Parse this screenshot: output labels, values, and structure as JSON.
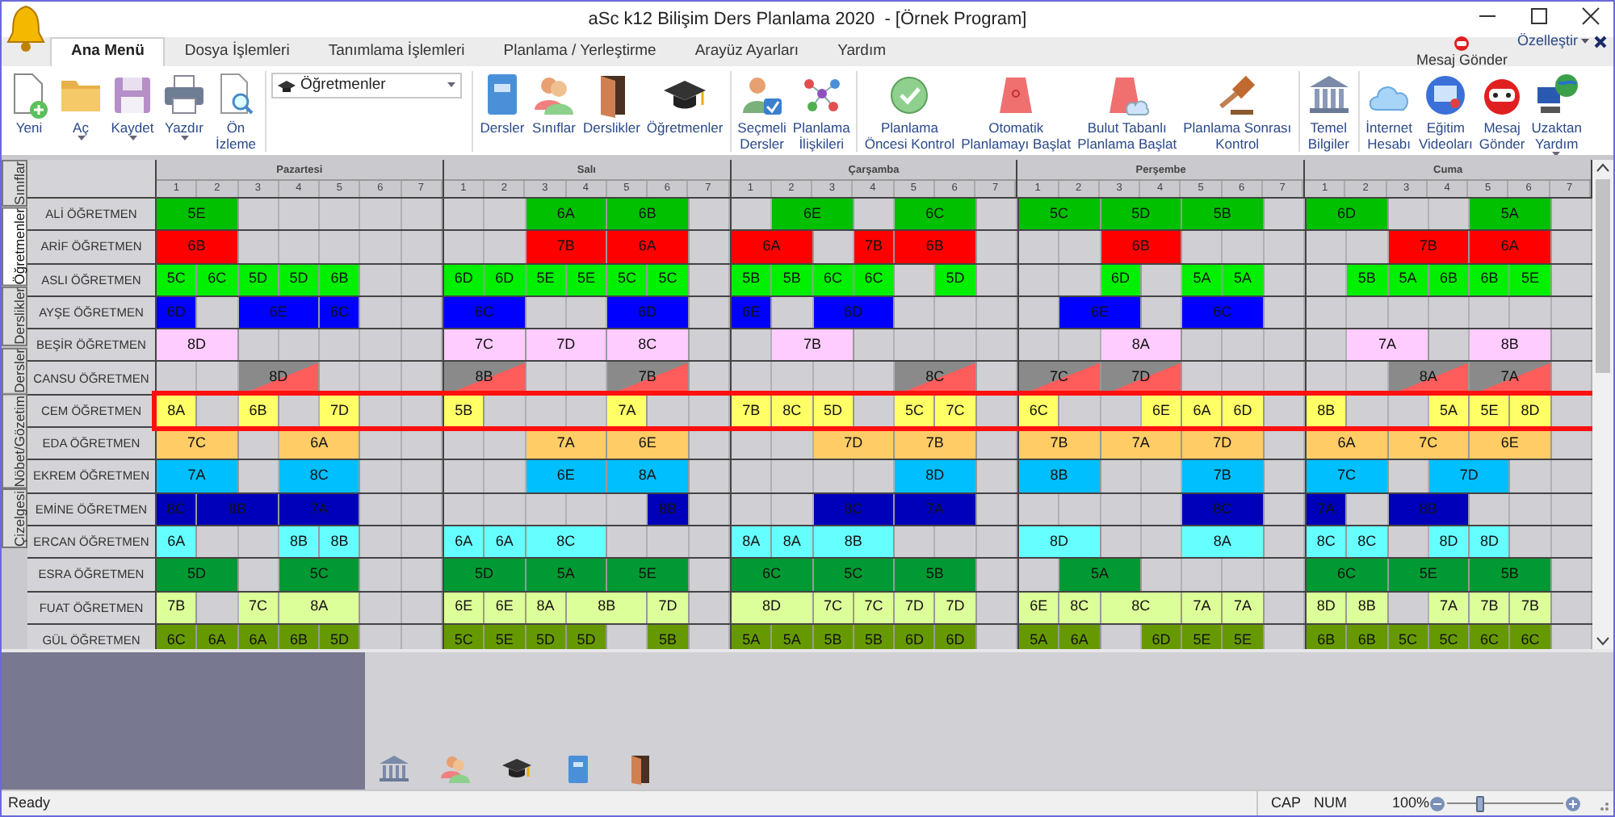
{
  "window": {
    "title": "aSc k12 Bilişim Ders Planlama 2020  - [Örnek Program]"
  },
  "ribbon_tabs": [
    {
      "label": "Ana Menü",
      "selected": true
    },
    {
      "label": "Dosya İşlemleri",
      "selected": false
    },
    {
      "label": "Tanımlama İşlemleri",
      "selected": false
    },
    {
      "label": "Planlama / Yerleştirme",
      "selected": false
    },
    {
      "label": "Arayüz Ayarları",
      "selected": false
    },
    {
      "label": "Yardım",
      "selected": false
    }
  ],
  "quick_bar": {
    "message": "Mesaj Gönder",
    "customize": "Özelleştir"
  },
  "ribbon": {
    "view_select": {
      "value": "Öğretmenler"
    },
    "groups": [
      [
        {
          "label": "Yeni",
          "dropdown": false
        },
        {
          "label": "Aç",
          "dropdown": true
        },
        {
          "label": "Kaydet",
          "dropdown": true
        },
        {
          "label": "Yazdır",
          "dropdown": true
        },
        {
          "label": "Ön\nİzleme",
          "dropdown": false
        }
      ],
      [
        {
          "label": "Dersler",
          "dropdown": false
        },
        {
          "label": "Sınıflar",
          "dropdown": false
        },
        {
          "label": "Derslikler",
          "dropdown": false
        },
        {
          "label": "Öğretmenler",
          "dropdown": false
        }
      ],
      [
        {
          "label": "Seçmeli\nDersler",
          "dropdown": false
        },
        {
          "label": "Planlama\nİlişkileri",
          "dropdown": false
        }
      ],
      [
        {
          "label": "Planlama\nÖncesi Kontrol",
          "dropdown": false
        },
        {
          "label": "Otomatik\nPlanlamayı Başlat",
          "dropdown": false
        },
        {
          "label": "Bulut Tabanlı\nPlanlama Başlat",
          "dropdown": false
        },
        {
          "label": "Planlama Sonrası\nKontrol",
          "dropdown": false
        }
      ],
      [
        {
          "label": "Temel\nBilgiler",
          "dropdown": false
        }
      ],
      [
        {
          "label": "İnternet\nHesabı",
          "dropdown": false
        },
        {
          "label": "Eğitim\nVideoları",
          "dropdown": false
        },
        {
          "label": "Mesaj\nGönder",
          "dropdown": false
        },
        {
          "label": "Uzaktan\nYardım",
          "dropdown": true
        }
      ]
    ]
  },
  "side_tabs": [
    {
      "label": "Sınıflar",
      "selected": false
    },
    {
      "label": "Öğretmenler",
      "selected": true
    },
    {
      "label": "Derslikler",
      "selected": false
    },
    {
      "label": "Dersler",
      "selected": false
    },
    {
      "label": "Nöbet/Gözetim",
      "selected": false
    },
    {
      "label": "Çizelgesi",
      "selected": false
    }
  ],
  "timetable": {
    "days": [
      {
        "name": "Pazartesi",
        "periods": [
          "1",
          "2",
          "3",
          "4",
          "5",
          "6",
          "7"
        ]
      },
      {
        "name": "Salı",
        "periods": [
          "1",
          "2",
          "3",
          "4",
          "5",
          "6",
          "7"
        ]
      },
      {
        "name": "Çarşamba",
        "periods": [
          "1",
          "2",
          "3",
          "4",
          "5",
          "6",
          "7"
        ]
      },
      {
        "name": "Perşembe",
        "periods": [
          "1",
          "2",
          "3",
          "4",
          "5",
          "6",
          "7"
        ]
      },
      {
        "name": "Cuma",
        "periods": [
          "1",
          "2",
          "3",
          "4",
          "5",
          "6",
          "7"
        ]
      }
    ],
    "teachers": [
      {
        "name": "ALİ ÖĞRETMEN",
        "color": "#00c000",
        "kind": "plain",
        "selected": false,
        "days": [
          [
            {
              "kind": "double",
              "class": "5E"
            },
            {
              "kind": "free"
            },
            {
              "kind": "free"
            },
            {
              "kind": "free"
            },
            {
              "kind": "free"
            },
            {
              "kind": "free"
            }
          ],
          [
            {
              "kind": "free"
            },
            {
              "kind": "free"
            },
            {
              "kind": "double",
              "class": "6A"
            },
            {
              "kind": "double",
              "class": "6B"
            },
            {
              "kind": "free"
            }
          ],
          [
            {
              "kind": "free"
            },
            {
              "kind": "double",
              "class": "6E"
            },
            {
              "kind": "free"
            },
            {
              "kind": "double",
              "class": "6C"
            },
            {
              "kind": "free"
            }
          ],
          [
            {
              "kind": "double",
              "class": "5C"
            },
            {
              "kind": "double",
              "class": "5D"
            },
            {
              "kind": "double",
              "class": "5B"
            },
            {
              "kind": "free"
            }
          ],
          [
            {
              "kind": "double",
              "class": "6D"
            },
            {
              "kind": "free"
            },
            {
              "kind": "free"
            },
            {
              "kind": "double",
              "class": "5A"
            },
            {
              "kind": "free"
            }
          ]
        ]
      },
      {
        "name": "ARİF ÖĞRETMEN",
        "color": "#ff0000",
        "kind": "plain",
        "selected": false,
        "days": [
          [
            {
              "kind": "double",
              "class": "6B"
            },
            {
              "kind": "free"
            },
            {
              "kind": "free"
            },
            {
              "kind": "free"
            },
            {
              "kind": "free"
            },
            {
              "kind": "free"
            }
          ],
          [
            {
              "kind": "free"
            },
            {
              "kind": "free"
            },
            {
              "kind": "double",
              "class": "7B"
            },
            {
              "kind": "double",
              "class": "6A"
            },
            {
              "kind": "free"
            }
          ],
          [
            {
              "kind": "double",
              "class": "6A"
            },
            {
              "kind": "free"
            },
            {
              "kind": "single",
              "class": "7B"
            },
            {
              "kind": "double",
              "class": "6B"
            },
            {
              "kind": "free"
            }
          ],
          [
            {
              "kind": "free"
            },
            {
              "kind": "free"
            },
            {
              "kind": "double",
              "class": "6B"
            },
            {
              "kind": "free"
            },
            {
              "kind": "free"
            },
            {
              "kind": "free"
            }
          ],
          [
            {
              "kind": "free"
            },
            {
              "kind": "free"
            },
            {
              "kind": "double",
              "class": "7B"
            },
            {
              "kind": "double",
              "class": "6A"
            },
            {
              "kind": "free"
            }
          ]
        ]
      },
      {
        "name": "ASLI ÖĞRETMEN",
        "color": "#00f000",
        "kind": "plain",
        "selected": false,
        "days": [
          [
            {
              "kind": "single",
              "class": "5C"
            },
            {
              "kind": "single",
              "class": "6C"
            },
            {
              "kind": "single",
              "class": "5D"
            },
            {
              "kind": "single",
              "class": "5D"
            },
            {
              "kind": "single",
              "class": "6B"
            },
            {
              "kind": "free"
            },
            {
              "kind": "free"
            }
          ],
          [
            {
              "kind": "single",
              "class": "6D"
            },
            {
              "kind": "single",
              "class": "6D"
            },
            {
              "kind": "single",
              "class": "5E"
            },
            {
              "kind": "single",
              "class": "5E"
            },
            {
              "kind": "single",
              "class": "5C"
            },
            {
              "kind": "single",
              "class": "5C"
            },
            {
              "kind": "free"
            }
          ],
          [
            {
              "kind": "single",
              "class": "5B"
            },
            {
              "kind": "single",
              "class": "5B"
            },
            {
              "kind": "single",
              "class": "6C"
            },
            {
              "kind": "single",
              "class": "6C"
            },
            {
              "kind": "free"
            },
            {
              "kind": "single",
              "class": "5D"
            },
            {
              "kind": "free"
            }
          ],
          [
            {
              "kind": "free"
            },
            {
              "kind": "free"
            },
            {
              "kind": "single",
              "class": "6D"
            },
            {
              "kind": "free"
            },
            {
              "kind": "single",
              "class": "5A"
            },
            {
              "kind": "single",
              "class": "5A"
            },
            {
              "kind": "free"
            }
          ],
          [
            {
              "kind": "free"
            },
            {
              "kind": "single",
              "class": "5B"
            },
            {
              "kind": "single",
              "class": "5A"
            },
            {
              "kind": "single",
              "class": "6B"
            },
            {
              "kind": "single",
              "class": "6B"
            },
            {
              "kind": "single",
              "class": "5E"
            },
            {
              "kind": "free"
            }
          ]
        ]
      },
      {
        "name": "AYŞE ÖĞRETMEN",
        "color": "#0000ff",
        "kind": "plain",
        "selected": false,
        "days": [
          [
            {
              "kind": "single",
              "class": "6D"
            },
            {
              "kind": "free"
            },
            {
              "kind": "double",
              "class": "6E"
            },
            {
              "kind": "single",
              "class": "6C"
            },
            {
              "kind": "free"
            },
            {
              "kind": "free"
            }
          ],
          [
            {
              "kind": "double",
              "class": "6C"
            },
            {
              "kind": "free"
            },
            {
              "kind": "free"
            },
            {
              "kind": "double",
              "class": "6D"
            },
            {
              "kind": "free"
            }
          ],
          [
            {
              "kind": "single",
              "class": "6E"
            },
            {
              "kind": "free"
            },
            {
              "kind": "double",
              "class": "6D"
            },
            {
              "kind": "free"
            },
            {
              "kind": "free"
            },
            {
              "kind": "free"
            }
          ],
          [
            {
              "kind": "free"
            },
            {
              "kind": "double",
              "class": "6E"
            },
            {
              "kind": "free"
            },
            {
              "kind": "double",
              "class": "6C"
            },
            {
              "kind": "free"
            }
          ],
          [
            {
              "kind": "free"
            },
            {
              "kind": "free"
            },
            {
              "kind": "free"
            },
            {
              "kind": "free"
            },
            {
              "kind": "free"
            },
            {
              "kind": "free"
            },
            {
              "kind": "free"
            }
          ]
        ]
      },
      {
        "name": "BEŞİR ÖĞRETMEN",
        "color": "#ffccff",
        "kind": "plain",
        "selected": false,
        "days": [
          [
            {
              "kind": "double",
              "class": "8D"
            },
            {
              "kind": "free"
            },
            {
              "kind": "free"
            },
            {
              "kind": "free"
            },
            {
              "kind": "free"
            },
            {
              "kind": "free"
            }
          ],
          [
            {
              "kind": "double",
              "class": "7C"
            },
            {
              "kind": "double",
              "class": "7D"
            },
            {
              "kind": "double",
              "class": "8C"
            },
            {
              "kind": "free"
            }
          ],
          [
            {
              "kind": "free"
            },
            {
              "kind": "double",
              "class": "7B"
            },
            {
              "kind": "free"
            },
            {
              "kind": "free"
            },
            {
              "kind": "free"
            },
            {
              "kind": "free"
            }
          ],
          [
            {
              "kind": "free"
            },
            {
              "kind": "free"
            },
            {
              "kind": "double",
              "class": "8A"
            },
            {
              "kind": "free"
            },
            {
              "kind": "free"
            },
            {
              "kind": "free"
            }
          ],
          [
            {
              "kind": "free"
            },
            {
              "kind": "double",
              "class": "7A"
            },
            {
              "kind": "free"
            },
            {
              "kind": "double",
              "class": "8B"
            },
            {
              "kind": "free"
            }
          ]
        ]
      },
      {
        "name": "CANSU ÖĞRETMEN",
        "color": "#8a8a8a",
        "kind": "flagged",
        "selected": false,
        "days": [
          [
            {
              "kind": "free"
            },
            {
              "kind": "free"
            },
            {
              "kind": "double",
              "class": "8D"
            },
            {
              "kind": "free"
            },
            {
              "kind": "free"
            },
            {
              "kind": "free"
            }
          ],
          [
            {
              "kind": "double",
              "class": "8B"
            },
            {
              "kind": "free"
            },
            {
              "kind": "free"
            },
            {
              "kind": "double",
              "class": "7B"
            },
            {
              "kind": "free"
            }
          ],
          [
            {
              "kind": "free"
            },
            {
              "kind": "free"
            },
            {
              "kind": "free"
            },
            {
              "kind": "free"
            },
            {
              "kind": "double",
              "class": "8C"
            },
            {
              "kind": "free"
            }
          ],
          [
            {
              "kind": "double",
              "class": "7C"
            },
            {
              "kind": "double",
              "class": "7D"
            },
            {
              "kind": "free"
            },
            {
              "kind": "free"
            },
            {
              "kind": "free"
            }
          ],
          [
            {
              "kind": "free"
            },
            {
              "kind": "free"
            },
            {
              "kind": "double",
              "class": "8A"
            },
            {
              "kind": "double",
              "class": "7A"
            },
            {
              "kind": "free"
            }
          ]
        ]
      },
      {
        "name": "CEM ÖĞRETMEN",
        "color": "#ffff66",
        "kind": "plain",
        "selected": true,
        "days": [
          [
            {
              "kind": "single",
              "class": "8A"
            },
            {
              "kind": "free"
            },
            {
              "kind": "single",
              "class": "6B"
            },
            {
              "kind": "free"
            },
            {
              "kind": "single",
              "class": "7D"
            },
            {
              "kind": "free"
            },
            {
              "kind": "free"
            }
          ],
          [
            {
              "kind": "single",
              "class": "5B"
            },
            {
              "kind": "free"
            },
            {
              "kind": "free"
            },
            {
              "kind": "free"
            },
            {
              "kind": "single",
              "class": "7A"
            },
            {
              "kind": "free"
            },
            {
              "kind": "free"
            }
          ],
          [
            {
              "kind": "single",
              "class": "7B"
            },
            {
              "kind": "single",
              "class": "8C"
            },
            {
              "kind": "single",
              "class": "5D"
            },
            {
              "kind": "free"
            },
            {
              "kind": "single",
              "class": "5C"
            },
            {
              "kind": "single",
              "class": "7C"
            },
            {
              "kind": "free"
            }
          ],
          [
            {
              "kind": "single",
              "class": "6C"
            },
            {
              "kind": "free"
            },
            {
              "kind": "free"
            },
            {
              "kind": "single",
              "class": "6E"
            },
            {
              "kind": "single",
              "class": "6A"
            },
            {
              "kind": "single",
              "class": "6D"
            },
            {
              "kind": "free"
            }
          ],
          [
            {
              "kind": "single",
              "class": "8B"
            },
            {
              "kind": "free"
            },
            {
              "kind": "free"
            },
            {
              "kind": "single",
              "class": "5A"
            },
            {
              "kind": "single",
              "class": "5E"
            },
            {
              "kind": "single",
              "class": "8D"
            },
            {
              "kind": "free"
            }
          ]
        ]
      },
      {
        "name": "EDA ÖĞRETMEN",
        "color": "#ffcc66",
        "kind": "plain",
        "selected": false,
        "days": [
          [
            {
              "kind": "double",
              "class": "7C"
            },
            {
              "kind": "free"
            },
            {
              "kind": "double",
              "class": "6A"
            },
            {
              "kind": "free"
            },
            {
              "kind": "free"
            }
          ],
          [
            {
              "kind": "free"
            },
            {
              "kind": "free"
            },
            {
              "kind": "double",
              "class": "7A"
            },
            {
              "kind": "double",
              "class": "6E"
            },
            {
              "kind": "free"
            }
          ],
          [
            {
              "kind": "free"
            },
            {
              "kind": "free"
            },
            {
              "kind": "double",
              "class": "7D"
            },
            {
              "kind": "double",
              "class": "7B"
            },
            {
              "kind": "free"
            }
          ],
          [
            {
              "kind": "double",
              "class": "7B"
            },
            {
              "kind": "double",
              "class": "7A"
            },
            {
              "kind": "double",
              "class": "7D"
            },
            {
              "kind": "free"
            }
          ],
          [
            {
              "kind": "double",
              "class": "6A"
            },
            {
              "kind": "double",
              "class": "7C"
            },
            {
              "kind": "double",
              "class": "6E"
            },
            {
              "kind": "free"
            }
          ]
        ]
      },
      {
        "name": "EKREM ÖĞRETMEN",
        "color": "#00bfff",
        "kind": "plain",
        "selected": false,
        "days": [
          [
            {
              "kind": "double",
              "class": "7A"
            },
            {
              "kind": "free"
            },
            {
              "kind": "double",
              "class": "8C"
            },
            {
              "kind": "free"
            },
            {
              "kind": "free"
            }
          ],
          [
            {
              "kind": "free"
            },
            {
              "kind": "free"
            },
            {
              "kind": "double",
              "class": "6E"
            },
            {
              "kind": "double",
              "class": "8A"
            },
            {
              "kind": "free"
            }
          ],
          [
            {
              "kind": "free"
            },
            {
              "kind": "free"
            },
            {
              "kind": "free"
            },
            {
              "kind": "free"
            },
            {
              "kind": "double",
              "class": "8D"
            },
            {
              "kind": "free"
            }
          ],
          [
            {
              "kind": "double",
              "class": "8B"
            },
            {
              "kind": "free"
            },
            {
              "kind": "free"
            },
            {
              "kind": "double",
              "class": "7B"
            },
            {
              "kind": "free"
            }
          ],
          [
            {
              "kind": "double",
              "class": "7C"
            },
            {
              "kind": "free"
            },
            {
              "kind": "double",
              "class": "7D"
            },
            {
              "kind": "free"
            },
            {
              "kind": "free"
            }
          ]
        ]
      },
      {
        "name": "EMİNE ÖĞRETMEN",
        "color": "#0000bb",
        "kind": "plain",
        "selected": false,
        "days": [
          [
            {
              "kind": "single",
              "class": "8C"
            },
            {
              "kind": "double",
              "class": "8B"
            },
            {
              "kind": "double",
              "class": "7A"
            },
            {
              "kind": "free"
            },
            {
              "kind": "free"
            }
          ],
          [
            {
              "kind": "free"
            },
            {
              "kind": "free"
            },
            {
              "kind": "free"
            },
            {
              "kind": "free"
            },
            {
              "kind": "free"
            },
            {
              "kind": "single",
              "class": "8B"
            },
            {
              "kind": "free"
            }
          ],
          [
            {
              "kind": "free"
            },
            {
              "kind": "free"
            },
            {
              "kind": "double",
              "class": "8C"
            },
            {
              "kind": "double",
              "class": "7A"
            },
            {
              "kind": "free"
            }
          ],
          [
            {
              "kind": "free"
            },
            {
              "kind": "free"
            },
            {
              "kind": "free"
            },
            {
              "kind": "free"
            },
            {
              "kind": "double",
              "class": "8C"
            },
            {
              "kind": "free"
            }
          ],
          [
            {
              "kind": "single",
              "class": "7A"
            },
            {
              "kind": "free"
            },
            {
              "kind": "double",
              "class": "8B"
            },
            {
              "kind": "free"
            },
            {
              "kind": "free"
            },
            {
              "kind": "free"
            }
          ]
        ]
      },
      {
        "name": "ERCAN ÖĞRETMEN",
        "color": "#66ffff",
        "kind": "plain",
        "selected": false,
        "days": [
          [
            {
              "kind": "single",
              "class": "6A"
            },
            {
              "kind": "free"
            },
            {
              "kind": "free"
            },
            {
              "kind": "single",
              "class": "8B"
            },
            {
              "kind": "single",
              "class": "8B"
            },
            {
              "kind": "free"
            },
            {
              "kind": "free"
            }
          ],
          [
            {
              "kind": "single",
              "class": "6A"
            },
            {
              "kind": "single",
              "class": "6A"
            },
            {
              "kind": "double",
              "class": "8C"
            },
            {
              "kind": "free"
            },
            {
              "kind": "free"
            },
            {
              "kind": "free"
            }
          ],
          [
            {
              "kind": "single",
              "class": "8A"
            },
            {
              "kind": "single",
              "class": "8A"
            },
            {
              "kind": "double",
              "class": "8B"
            },
            {
              "kind": "free"
            },
            {
              "kind": "free"
            },
            {
              "kind": "free"
            }
          ],
          [
            {
              "kind": "double",
              "class": "8D"
            },
            {
              "kind": "free"
            },
            {
              "kind": "free"
            },
            {
              "kind": "double",
              "class": "8A"
            },
            {
              "kind": "free"
            }
          ],
          [
            {
              "kind": "single",
              "class": "8C"
            },
            {
              "kind": "single",
              "class": "8C"
            },
            {
              "kind": "free"
            },
            {
              "kind": "single",
              "class": "8D"
            },
            {
              "kind": "single",
              "class": "8D"
            },
            {
              "kind": "free"
            },
            {
              "kind": "free"
            }
          ]
        ]
      },
      {
        "name": "ESRA ÖĞRETMEN",
        "color": "#009933",
        "kind": "plain",
        "selected": false,
        "days": [
          [
            {
              "kind": "double",
              "class": "5D"
            },
            {
              "kind": "free"
            },
            {
              "kind": "double",
              "class": "5C"
            },
            {
              "kind": "free"
            },
            {
              "kind": "free"
            }
          ],
          [
            {
              "kind": "double",
              "class": "5D"
            },
            {
              "kind": "double",
              "class": "5A"
            },
            {
              "kind": "double",
              "class": "5E"
            },
            {
              "kind": "free"
            }
          ],
          [
            {
              "kind": "double",
              "class": "6C"
            },
            {
              "kind": "double",
              "class": "5C"
            },
            {
              "kind": "double",
              "class": "5B"
            },
            {
              "kind": "free"
            }
          ],
          [
            {
              "kind": "free"
            },
            {
              "kind": "double",
              "class": "5A"
            },
            {
              "kind": "free"
            },
            {
              "kind": "free"
            },
            {
              "kind": "free"
            },
            {
              "kind": "free"
            }
          ],
          [
            {
              "kind": "double",
              "class": "6C"
            },
            {
              "kind": "double",
              "class": "5E"
            },
            {
              "kind": "double",
              "class": "5B"
            },
            {
              "kind": "free"
            }
          ]
        ]
      },
      {
        "name": "FUAT ÖĞRETMEN",
        "color": "#ddff99",
        "kind": "plain",
        "selected": false,
        "days": [
          [
            {
              "kind": "single",
              "class": "7B"
            },
            {
              "kind": "free"
            },
            {
              "kind": "single",
              "class": "7C"
            },
            {
              "kind": "double",
              "class": "8A"
            },
            {
              "kind": "free"
            },
            {
              "kind": "free"
            }
          ],
          [
            {
              "kind": "single",
              "class": "6E"
            },
            {
              "kind": "single",
              "class": "6E"
            },
            {
              "kind": "single",
              "class": "8A"
            },
            {
              "kind": "double",
              "class": "8B"
            },
            {
              "kind": "single",
              "class": "7D"
            },
            {
              "kind": "free"
            }
          ],
          [
            {
              "kind": "double",
              "class": "8D"
            },
            {
              "kind": "single",
              "class": "7C"
            },
            {
              "kind": "single",
              "class": "7C"
            },
            {
              "kind": "single",
              "class": "7D"
            },
            {
              "kind": "single",
              "class": "7D"
            },
            {
              "kind": "free"
            }
          ],
          [
            {
              "kind": "single",
              "class": "6E"
            },
            {
              "kind": "single",
              "class": "8C"
            },
            {
              "kind": "double",
              "class": "8C"
            },
            {
              "kind": "single",
              "class": "7A"
            },
            {
              "kind": "single",
              "class": "7A"
            },
            {
              "kind": "free"
            }
          ],
          [
            {
              "kind": "single",
              "class": "8D"
            },
            {
              "kind": "single",
              "class": "8B"
            },
            {
              "kind": "free"
            },
            {
              "kind": "single",
              "class": "7A"
            },
            {
              "kind": "single",
              "class": "7B"
            },
            {
              "kind": "single",
              "class": "7B"
            },
            {
              "kind": "free"
            }
          ]
        ]
      },
      {
        "name": "GÜL ÖĞRETMEN",
        "color": "#669900",
        "kind": "plain",
        "selected": false,
        "days": [
          [
            {
              "kind": "single",
              "class": "6C"
            },
            {
              "kind": "single",
              "class": "6A"
            },
            {
              "kind": "single",
              "class": "6A"
            },
            {
              "kind": "single",
              "class": "6B"
            },
            {
              "kind": "single",
              "class": "5D"
            },
            {
              "kind": "free"
            },
            {
              "kind": "free"
            }
          ],
          [
            {
              "kind": "single",
              "class": "5C"
            },
            {
              "kind": "single",
              "class": "5E"
            },
            {
              "kind": "single",
              "class": "5D"
            },
            {
              "kind": "single",
              "class": "5D"
            },
            {
              "kind": "free"
            },
            {
              "kind": "single",
              "class": "5B"
            },
            {
              "kind": "free"
            }
          ],
          [
            {
              "kind": "single",
              "class": "5A"
            },
            {
              "kind": "single",
              "class": "5A"
            },
            {
              "kind": "single",
              "class": "5B"
            },
            {
              "kind": "single",
              "class": "5B"
            },
            {
              "kind": "single",
              "class": "6D"
            },
            {
              "kind": "single",
              "class": "6D"
            },
            {
              "kind": "free"
            }
          ],
          [
            {
              "kind": "single",
              "class": "5A"
            },
            {
              "kind": "single",
              "class": "6A"
            },
            {
              "kind": "free"
            },
            {
              "kind": "single",
              "class": "6D"
            },
            {
              "kind": "single",
              "class": "5E"
            },
            {
              "kind": "single",
              "class": "5E"
            },
            {
              "kind": "free"
            }
          ],
          [
            {
              "kind": "single",
              "class": "6B"
            },
            {
              "kind": "single",
              "class": "6B"
            },
            {
              "kind": "single",
              "class": "5C"
            },
            {
              "kind": "single",
              "class": "5C"
            },
            {
              "kind": "single",
              "class": "6C"
            },
            {
              "kind": "single",
              "class": "6C"
            },
            {
              "kind": "free"
            }
          ]
        ]
      }
    ]
  },
  "status_bar": {
    "text": "Ready",
    "indicators": [
      "CAP",
      "NUM"
    ],
    "zoom": {
      "reading": "100%",
      "level": 0.28
    }
  }
}
